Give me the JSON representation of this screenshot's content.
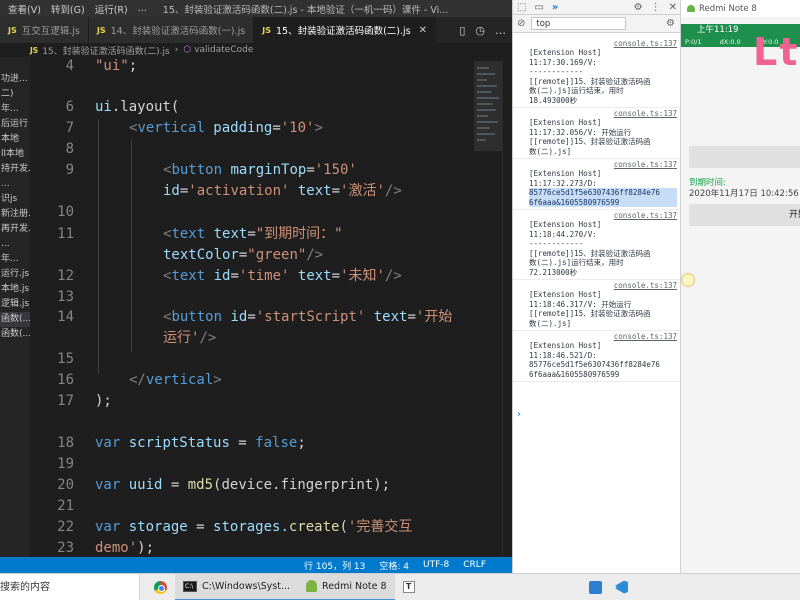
{
  "vscode": {
    "menubar": {
      "items": [
        "查看(V)",
        "转到(G)",
        "运行(R)",
        "..."
      ],
      "window_title": "15、封装验证激活码函数(二).js - 本地验证（一机一码）课件 - Vi..."
    },
    "tabs": [
      {
        "icon": "JS",
        "label": "互交互逻辑.js"
      },
      {
        "icon": "JS",
        "label": "14、封装验证激活码函数(一).js"
      },
      {
        "icon": "JS",
        "label": "15、封装验证激活码函数(二).js"
      }
    ],
    "breadcrumb": {
      "file": "15、封装验证激活码函数(二).js",
      "separator": "›",
      "symbol": "validateCode"
    },
    "explorer_items": [
      "",
      "功进...",
      "二)",
      "年...",
      "后运行",
      "本地",
      "ll本地",
      "持开发...",
      "...",
      "识js",
      "新注册...",
      "再开发...",
      "...",
      "年...",
      "运行.js",
      "本地.js",
      "逻辑.js",
      "函数(...",
      "函数(..."
    ],
    "line_numbers": [
      "4",
      "6",
      "7",
      "8",
      "9",
      "10",
      "11",
      "12",
      "13",
      "14",
      "15",
      "16",
      "17",
      "18",
      "19",
      "20",
      "21",
      "22",
      "23"
    ],
    "code": {
      "l4_str": "\"ui\"",
      "l4_end": ";",
      "l6_kw": "ui",
      "l6_rest": ".layout(",
      "l7_open": "<",
      "l7_tag": "vertical",
      "l7_attr": " padding",
      "l7_eq": "=",
      "l7_val": "'10'",
      "l7_close": ">",
      "l9_open": "<",
      "l9_tag": "button",
      "l9_attr": " marginTop",
      "l9_eq": "=",
      "l9_val": "'150'",
      "l9b_attr1": "id",
      "l9b_eq1": "=",
      "l9b_val1": "'activation'",
      "l9b_attr2": " text",
      "l9b_eq2": "=",
      "l9b_val2": "'激活'",
      "l9b_close": "/>",
      "l11_open": "<",
      "l11_tag": "text",
      "l11_attr": " text",
      "l11_eq": "=",
      "l11_val": "\"到期时间：\"",
      "l11b_attr": "textColor",
      "l11b_eq": "=",
      "l11b_val": "\"green\"",
      "l11b_close": "/>",
      "l12_open": "<",
      "l12_tag": "text",
      "l12_attr1": " id",
      "l12_eq1": "=",
      "l12_val1": "'time'",
      "l12_attr2": " text",
      "l12_eq2": "=",
      "l12_val2": "'未知'",
      "l12_close": "/>",
      "l14_open": "<",
      "l14_tag": "button",
      "l14_attr1": " id",
      "l14_eq1": "=",
      "l14_val1": "'startScript'",
      "l14_attr2": " text",
      "l14_eq2": "=",
      "l14_val2": "'开始",
      "l14b_val": "运行'",
      "l14b_close": "/>",
      "l16_open": "</",
      "l16_tag": "vertical",
      "l16_close": ">",
      "l17": ");",
      "l19_kw": "var",
      "l19_var": " scriptStatus",
      "l19_eq": " = ",
      "l19_val": "false",
      "l19_end": ";",
      "l21_kw": "var",
      "l21_var": " uuid",
      "l21_eq": " = ",
      "l21_fn": "md5",
      "l21_rest": "(device.fingerprint);",
      "l23_kw": "var",
      "l23_var": " storage",
      "l23_eq": " = ",
      "l23_obj": "storages.",
      "l23_fn": "create",
      "l23_paren": "(",
      "l23_str": "'完善交互",
      "l23b_str": "demo'",
      "l23b_end": ");"
    },
    "statusbar": {
      "position": "行 105，列 13",
      "spaces": "空格: 4",
      "encoding": "UTF-8",
      "eol": "CRLF"
    }
  },
  "devtools": {
    "context": "top",
    "entries": [
      {
        "src": "console.ts:137",
        "lines": [
          "[Extension Host]",
          "11:17:30.169/V:",
          "------------",
          "[[remote]]15、封装验证激活码函",
          "数(二).js]运行结束，用时",
          "18.493000秒"
        ]
      },
      {
        "src": "console.ts:137",
        "lines": [
          "[Extension Host]",
          "11:17:32.056/V: 开始运行",
          "[[remote]]15、封装验证激活码函",
          "数(二).js]"
        ]
      },
      {
        "src": "console.ts:137",
        "lines": [
          "[Extension Host]",
          "11:17:32.273/D:",
          "85776ce5d1f5e6307436ff8284e76",
          "6f6aaa&1605580976599"
        ],
        "highlight": [
          2,
          3
        ]
      },
      {
        "src": "console.ts:137",
        "lines": [
          "[Extension Host]",
          "11:18:44.270/V:",
          "------------",
          "[[remote]]15、封装验证激活码函",
          "数(二).js]运行结束，用时",
          "72.213000秒"
        ]
      },
      {
        "src": "console.ts:137",
        "lines": [
          "[Extension Host]",
          "11:18:46.317/V: 开始运行",
          "[[remote]]15、封装验证激活码函",
          "数(二).js]"
        ]
      },
      {
        "src": "console.ts:137",
        "lines": [
          "[Extension Host]",
          "11:18:46.521/D:",
          "85776ce5d1f5e6307436ff8284e76",
          "6f6aaa&1605580976599"
        ]
      }
    ],
    "prompt": "›"
  },
  "phone": {
    "title": "Redmi Note 8",
    "status_time": "上午11:19",
    "status_icons": [
      "P:0/1",
      "dX:0.0",
      "dY:0.0"
    ],
    "watermark": "Lt",
    "expire_label": "到期时间:",
    "expire_time": "2020年11月17日 10:42:56",
    "start_button": "开始"
  },
  "taskbar": {
    "search": "搜索的内容",
    "items": [
      {
        "icon": "chrome-icon",
        "label": ""
      },
      {
        "icon": "cmd-icon",
        "label": "C:\\Windows\\Syst..."
      },
      {
        "icon": "android-icon",
        "label": "Redmi Note 8"
      },
      {
        "icon": "typora-icon",
        "label": ""
      }
    ]
  },
  "colors": {
    "editor_bg": "#1e1e1e",
    "status_blue": "#007acc",
    "string": "#ce9178",
    "keyword": "#569cd6",
    "attribute": "#9cdcfe",
    "phone_green": "#1f8f4e"
  }
}
